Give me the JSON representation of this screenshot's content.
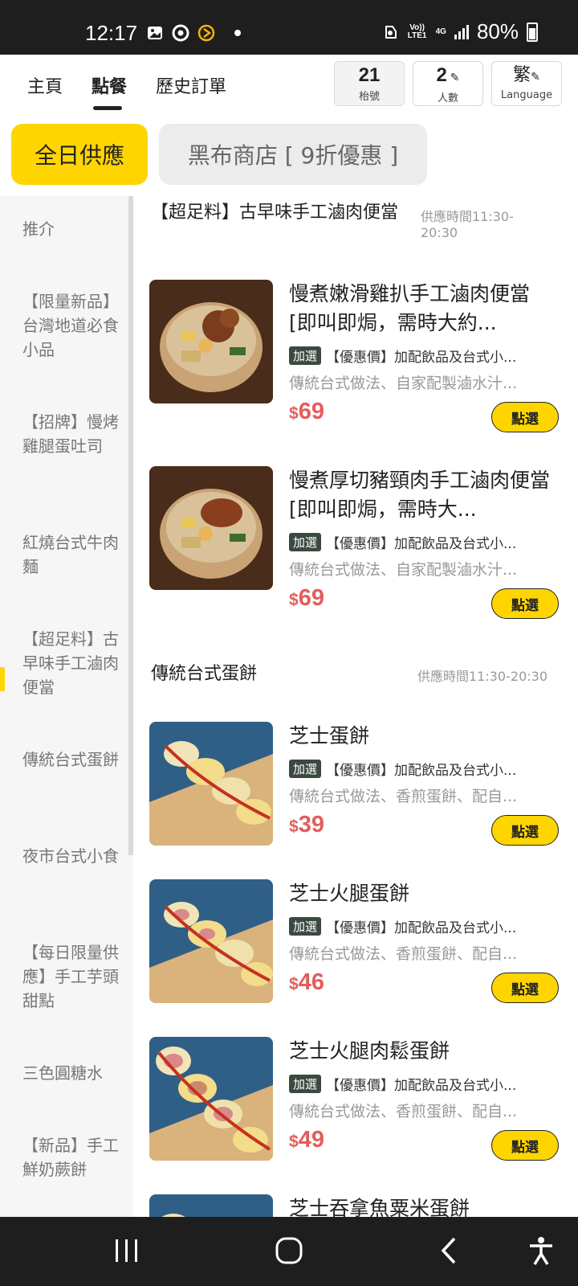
{
  "status_bar": {
    "time": "12:17",
    "network_top": "Vo)) LTE1",
    "network_gen": "4G",
    "battery": "80%"
  },
  "nav": {
    "tabs": [
      {
        "label": "主頁"
      },
      {
        "label": "點餐",
        "active": true
      },
      {
        "label": "歷史訂單"
      }
    ],
    "table_number": "21",
    "table_label": "枱號",
    "people_count": "2",
    "people_label": "人數",
    "language_char": "繁",
    "language_label": "Language"
  },
  "menu_tabs": [
    {
      "label": "全日供應",
      "active": true
    },
    {
      "label": "黑布商店 [ 9折優惠 ]"
    }
  ],
  "sidebar": {
    "items": [
      {
        "label": "推介"
      },
      {
        "label": "【限量新品】台灣地道必食小品"
      },
      {
        "label": "【招牌】慢烤雞腿蛋吐司"
      },
      {
        "label": "紅燒台式牛肉麵"
      },
      {
        "label": "【超足料】古早味手工滷肉便當",
        "active": true
      },
      {
        "label": "傳統台式蛋餅"
      },
      {
        "label": "夜市台式小食"
      },
      {
        "label": "【每日限量供應】手工芋頭甜點"
      },
      {
        "label": "三色圓糖水"
      },
      {
        "label": "【新品】手工鮮奶蕨餅"
      }
    ]
  },
  "sections": [
    {
      "title": "【超足料】古早味手工滷肉便當",
      "time": "供應時間11:30-20:30",
      "items": [
        {
          "name": "慢煮嫩滑雞扒手工滷肉便當 [即叫即焗，需時大約...",
          "tag": "加選",
          "promo": "【優惠價】加配飲品及台式小...",
          "desc": "傳統台式做法、自家配製滷水汁...",
          "currency": "$",
          "price": "69",
          "button": "點選"
        },
        {
          "name": "慢煮厚切豬頸肉手工滷肉便當 [即叫即焗，需時大...",
          "tag": "加選",
          "promo": "【優惠價】加配飲品及台式小...",
          "desc": "傳統台式做法、自家配製滷水汁...",
          "currency": "$",
          "price": "69",
          "button": "點選"
        }
      ]
    },
    {
      "title": "傳統台式蛋餅",
      "time": "供應時間11:30-20:30",
      "items": [
        {
          "name": "芝士蛋餅",
          "tag": "加選",
          "promo": "【優惠價】加配飲品及台式小...",
          "desc": "傳統台式做法、香煎蛋餅、配自...",
          "currency": "$",
          "price": "39",
          "button": "點選"
        },
        {
          "name": "芝士火腿蛋餅",
          "tag": "加選",
          "promo": "【優惠價】加配飲品及台式小...",
          "desc": "傳統台式做法、香煎蛋餅、配自...",
          "currency": "$",
          "price": "46",
          "button": "點選"
        },
        {
          "name": "芝士火腿肉鬆蛋餅",
          "tag": "加選",
          "promo": "【優惠價】加配飲品及台式小...",
          "desc": "傳統台式做法、香煎蛋餅、配自...",
          "currency": "$",
          "price": "49",
          "button": "點選"
        },
        {
          "name": "芝士吞拿魚粟米蛋餅"
        }
      ]
    }
  ],
  "colors": {
    "accent": "#ffd500",
    "price": "#e35d5b",
    "tag": "#3b4a40"
  }
}
